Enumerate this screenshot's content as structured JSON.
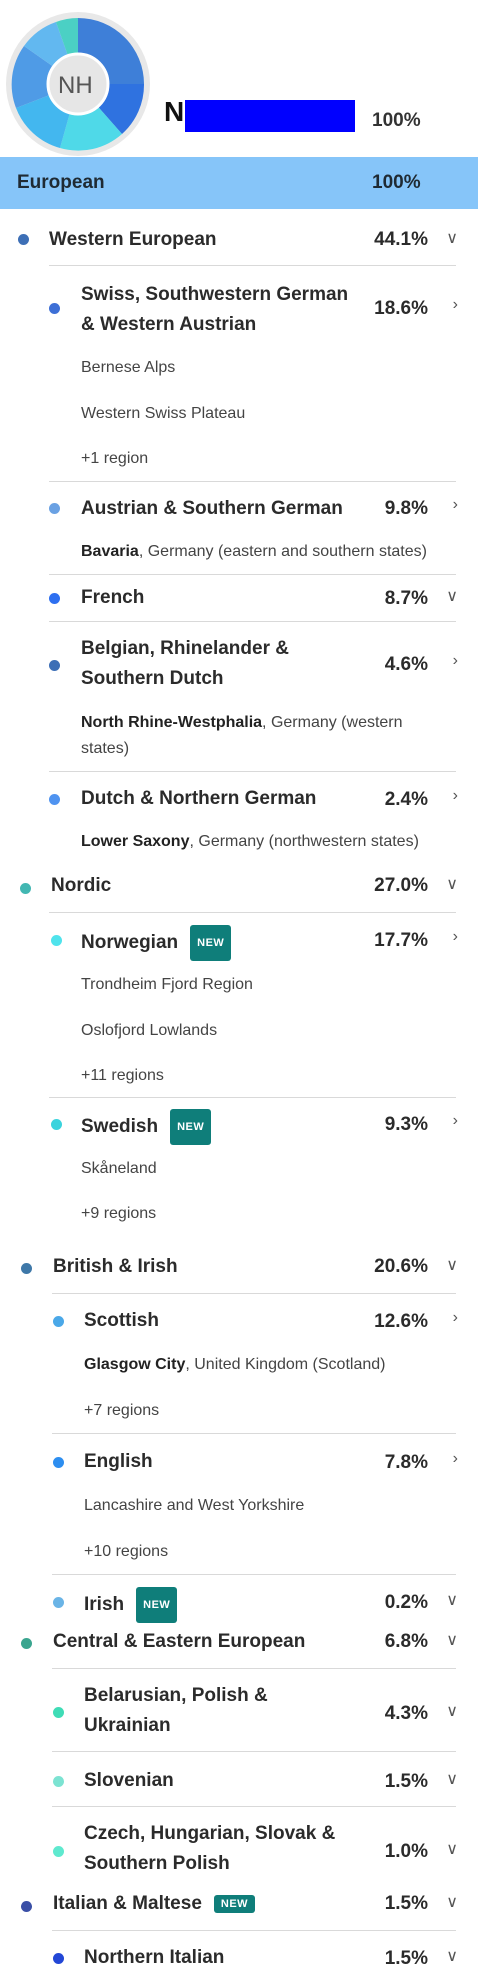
{
  "header": {
    "avatar_initials": "NH",
    "name_initial": "N",
    "total_pct": "100%"
  },
  "colors": {
    "accent_bar": "#86c5f9",
    "badge": "#0f7e7a",
    "redaction": "#0000ff"
  },
  "european": {
    "label": "European",
    "pct": "100%"
  },
  "new_badge": "NEW",
  "groups": {
    "western": {
      "label": "Western European",
      "pct": "44.1%",
      "swiss": {
        "label_l1": "Swiss, Southwestern German",
        "label_l2": "& Western Austrian",
        "pct": "18.6%",
        "r1": "Bernese Alps",
        "r2": "Western Swiss Plateau",
        "more": "+1 region"
      },
      "austrian": {
        "label": "Austrian & Southern German",
        "pct": "9.8%",
        "region_bold": "Bavaria",
        "region_rest": ", Germany (eastern and southern states)"
      },
      "french": {
        "label": "French",
        "pct": "8.7%"
      },
      "belgian": {
        "label_l1": "Belgian, Rhinelander &",
        "label_l2": "Southern Dutch",
        "pct": "4.6%",
        "region_bold": "North Rhine-Westphalia",
        "region_rest": ", Germany (western",
        "region_rest2": "states)"
      },
      "dutch": {
        "label": "Dutch & Northern German",
        "pct": "2.4%",
        "region_bold": "Lower Saxony",
        "region_rest": ", Germany (northwestern states)"
      }
    },
    "nordic": {
      "label": "Nordic",
      "pct": "27.0%",
      "norwegian": {
        "label": "Norwegian",
        "pct": "17.7%",
        "r1": "Trondheim Fjord Region",
        "r2": "Oslofjord Lowlands",
        "more": "+11 regions"
      },
      "swedish": {
        "label": "Swedish",
        "pct": "9.3%",
        "r1": "Skåneland",
        "more": "+9 regions"
      }
    },
    "british": {
      "label": "British & Irish",
      "pct": "20.6%",
      "scottish": {
        "label": "Scottish",
        "pct": "12.6%",
        "region_bold": "Glasgow City",
        "region_rest": ", United Kingdom (Scotland)",
        "more": "+7 regions"
      },
      "english": {
        "label": "English",
        "pct": "7.8%",
        "r1": "Lancashire and West Yorkshire",
        "more": "+10 regions"
      },
      "irish": {
        "label": "Irish",
        "pct": "0.2%"
      }
    },
    "central": {
      "label": "Central & Eastern European",
      "pct": "6.8%",
      "belarusian": {
        "label_l1": "Belarusian, Polish &",
        "label_l2": "Ukrainian",
        "pct": "4.3%"
      },
      "slovenian": {
        "label": "Slovenian",
        "pct": "1.5%"
      },
      "czech": {
        "label_l1": "Czech, Hungarian, Slovak &",
        "label_l2": "Southern Polish",
        "pct": "1.0%"
      }
    },
    "italian": {
      "label": "Italian & Maltese",
      "pct": "1.5%",
      "northern": {
        "label": "Northern Italian",
        "pct": "1.5%"
      }
    }
  }
}
